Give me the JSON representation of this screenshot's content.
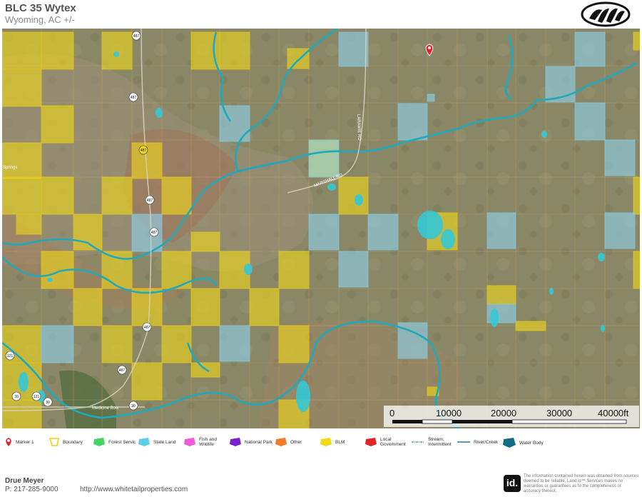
{
  "header": {
    "title": "BLC 35 Wytex",
    "subtitle": "Wyoming,  AC +/-"
  },
  "map": {
    "place_labels": {
      "medicine_bow": "Medicine Bow",
      "springs": "Springs",
      "marshall_rd": "MARSHALL RD",
      "laramie_rd": "LARAMIE RD"
    },
    "route_shields": [
      "487",
      "487",
      "487",
      "487",
      "487",
      "487",
      "487",
      "121",
      "121",
      "30",
      "30",
      "30"
    ],
    "scale": {
      "labels": [
        "0",
        "10000",
        "20000",
        "30000",
        "40000ft"
      ]
    }
  },
  "legend": {
    "items": [
      {
        "label": "Marker 1",
        "icon": "map-pin-icon",
        "color": "#e8202a"
      },
      {
        "label": "Boundary",
        "icon": "boundary-icon",
        "color": "#e8d21c"
      },
      {
        "label": "Forest Servic",
        "icon": "forest-service-icon",
        "color": "#44d46a"
      },
      {
        "label": "State Land",
        "icon": "state-land-icon",
        "color": "#5ccfe6"
      },
      {
        "label": "Fish and Wildlife",
        "icon": "fish-wildlife-icon",
        "color": "#f05ad6"
      },
      {
        "label": "National Park",
        "icon": "national-park-icon",
        "color": "#7a1fd1"
      },
      {
        "label": "Other",
        "icon": "other-land-icon",
        "color": "#f07a2a"
      },
      {
        "label": "BLM",
        "icon": "blm-icon",
        "color": "#f2d81a"
      },
      {
        "label": "Local Government",
        "icon": "local-government-icon",
        "color": "#e0242c"
      },
      {
        "label": "Stream, Intermittent",
        "icon": "stream-intermittent-icon",
        "color": "#2a7c96"
      },
      {
        "label": "River/Creek",
        "icon": "river-creek-icon",
        "color": "#2a7c96"
      },
      {
        "label": "Water Body",
        "icon": "water-body-icon",
        "color": "#146b86"
      }
    ]
  },
  "footer": {
    "name": "Drue Meyer",
    "phone": "P: 217-285-9000",
    "url": "http://www.whitetailproperties.com",
    "id_badge": "id.",
    "disclaimer": "The information contained herein was obtained from sources deemed to be reliable. Land id™ Services makes no warranties or guarantees as to the completeness or accuracy thereof."
  }
}
